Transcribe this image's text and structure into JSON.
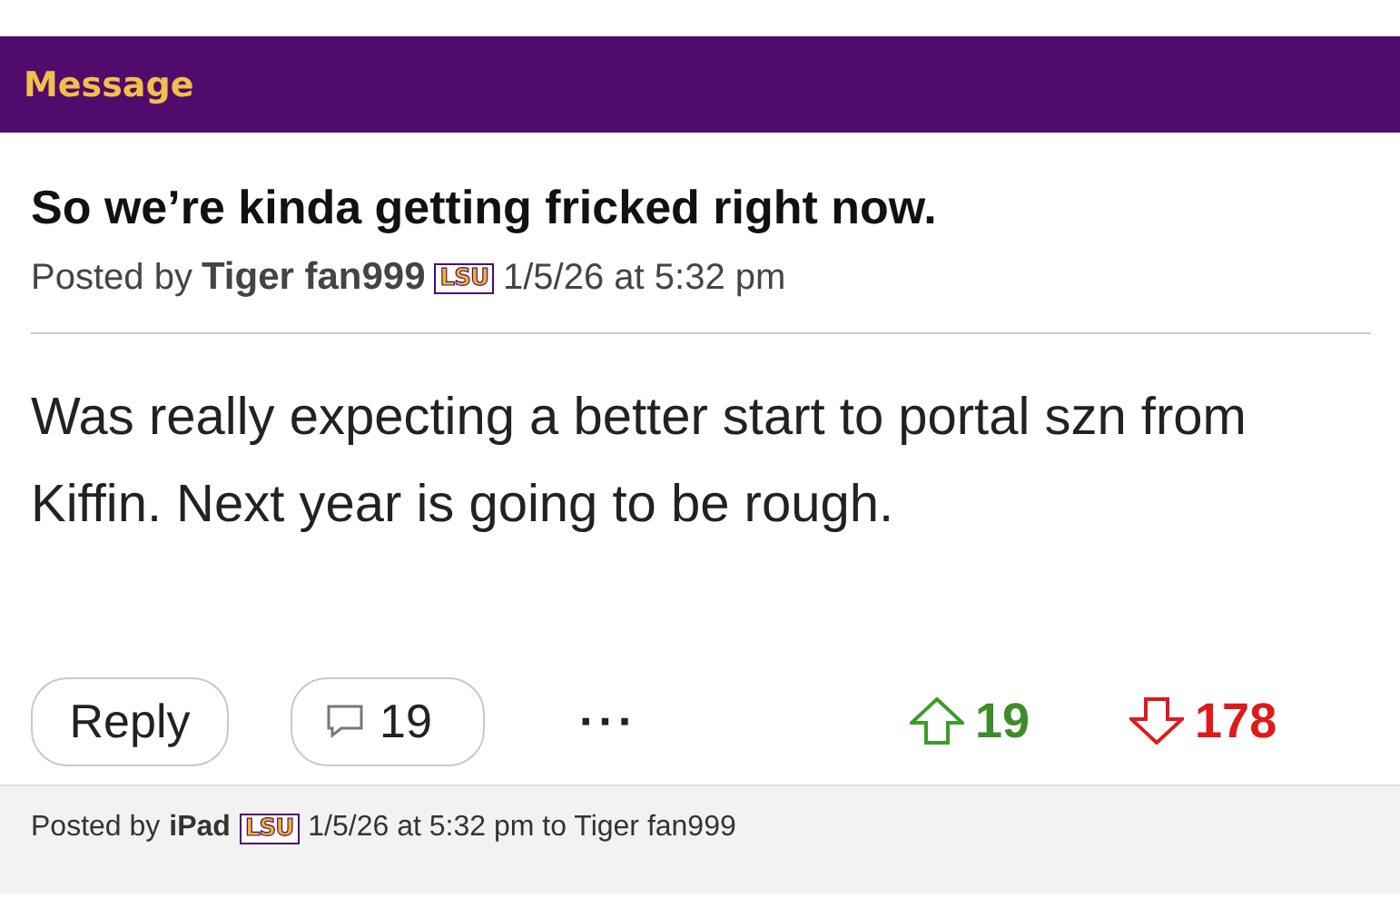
{
  "header": {
    "title": "Message"
  },
  "post": {
    "title": "So we’re kinda getting fricked right now.",
    "posted_by_label": "Posted by",
    "author": "Tiger fan999",
    "team_badge": "LSU",
    "timestamp": "1/5/26 at 5:32 pm",
    "body": "Was really expecting a better start to portal szn from Kiffin. Next year is going to be rough."
  },
  "actions": {
    "reply": "Reply",
    "comments": "19",
    "more": "···",
    "upvotes": "19",
    "downvotes": "178"
  },
  "next_post": {
    "posted_by_label": "Posted by",
    "author": "iPad",
    "team_badge": "LSU",
    "meta": "1/5/26 at 5:32 pm to Tiger fan999"
  }
}
